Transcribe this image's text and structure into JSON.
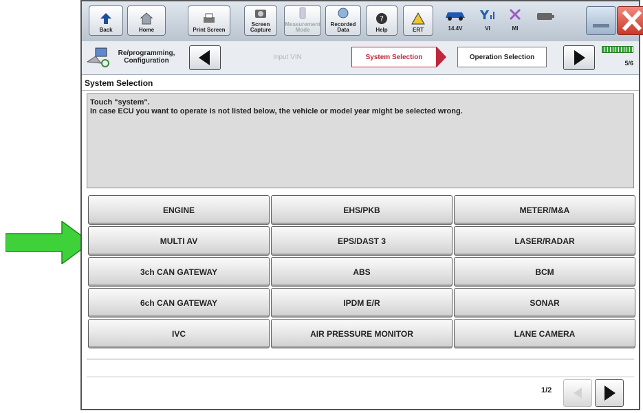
{
  "toolbar": {
    "back": "Back",
    "home": "Home",
    "print_screen": "Print Screen",
    "screen_capture": "Screen Capture",
    "measurement_mode": "Measurement Mode",
    "recorded_data": "Recorded Data",
    "help": "Help",
    "ert": "ERT",
    "voltage": "14.4V",
    "vi": "VI",
    "mi": "MI"
  },
  "crumbs": {
    "reprogramming": "Re/programming, Configuration",
    "input_vin": "Input VIN",
    "system_selection": "System Selection",
    "operation_selection": "Operation Selection",
    "step": "5/6"
  },
  "section_title": "System Selection",
  "message": {
    "line1": "Touch \"system\".",
    "line2": "In case ECU you want to operate is not listed below, the vehicle or model year might be selected wrong."
  },
  "systems": [
    [
      "ENGINE",
      "EHS/PKB",
      "METER/M&A"
    ],
    [
      "MULTI AV",
      "EPS/DAST 3",
      "LASER/RADAR"
    ],
    [
      "3ch CAN GATEWAY",
      "ABS",
      "BCM"
    ],
    [
      "6ch CAN GATEWAY",
      "IPDM E/R",
      "SONAR"
    ],
    [
      "IVC",
      "AIR PRESSURE MONITOR",
      "LANE CAMERA"
    ]
  ],
  "page_indicator": "1/2",
  "colors": {
    "active_crumb": "#c0263c",
    "pointer_arrow": "#33cc33",
    "close_button": "#d9463a"
  }
}
